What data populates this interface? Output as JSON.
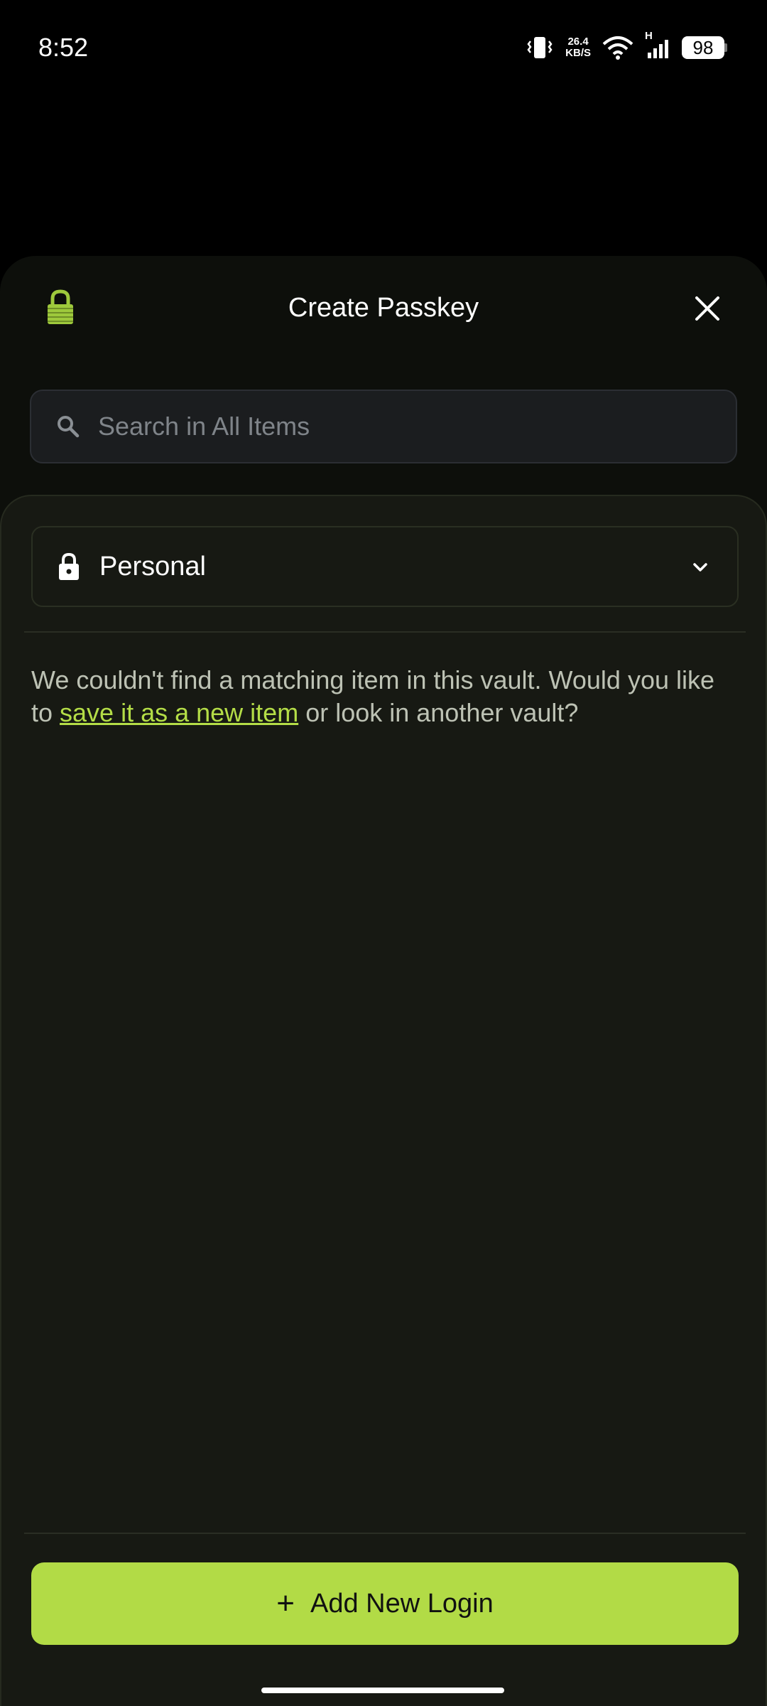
{
  "status_bar": {
    "time": "8:52",
    "net_speed_value": "26.4",
    "net_speed_unit": "KB/S",
    "network_type": "H",
    "battery": "98",
    "icons": [
      "vibrate-icon",
      "wifi-icon",
      "cellular-signal-icon",
      "battery-icon"
    ]
  },
  "sheet": {
    "title": "Create Passkey",
    "logo_icon": "padlock-logo-icon",
    "close_icon": "close-icon"
  },
  "search": {
    "placeholder": "Search in All Items",
    "value": ""
  },
  "vault": {
    "selected": "Personal",
    "icon": "lock-icon",
    "chevron": "chevron-down-icon"
  },
  "message": {
    "before": "We couldn't find a matching item in this vault. Would you like to ",
    "link": "save it as a new item",
    "after": " or look in another vault?"
  },
  "actions": {
    "add_login_plus": "+",
    "add_login_label": "Add New Login"
  },
  "colors": {
    "accent": "#b2db46",
    "link": "#b4dd47",
    "sheet_bg": "#0d0f0b",
    "panel_bg": "#171913",
    "text_muted": "#bdc2b4"
  }
}
